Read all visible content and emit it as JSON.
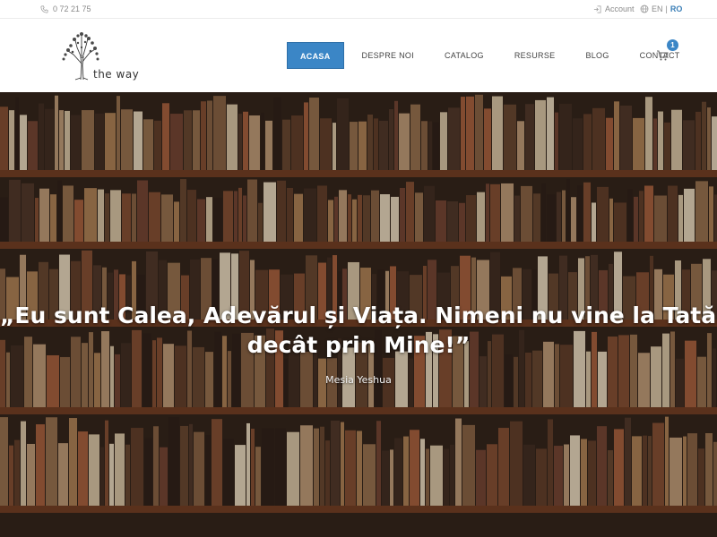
{
  "topbar": {
    "phone": "0  72 21   75",
    "account_label": "Account",
    "lang_en": "EN",
    "lang_sep": "|",
    "lang_ro": "RO"
  },
  "brand": {
    "logo_text": "the way"
  },
  "nav": {
    "items": [
      {
        "label": "ACASA",
        "active": true
      },
      {
        "label": "DESPRE NOI"
      },
      {
        "label": "CATALOG"
      },
      {
        "label": "RESURSE"
      },
      {
        "label": "BLOG"
      },
      {
        "label": "CONTACT"
      }
    ]
  },
  "cart": {
    "count": "1",
    "icon": "cart-icon"
  },
  "hero": {
    "quote_line1": "„Eu sunt Calea, Adevărul și Viața. Nimeni nu vine la Tatăl",
    "quote_line2": "decât prin Mine!”",
    "author": "Mesia Yeshua"
  },
  "colors": {
    "accent": "#3b86c6",
    "hero_bg": "#2e2119"
  }
}
